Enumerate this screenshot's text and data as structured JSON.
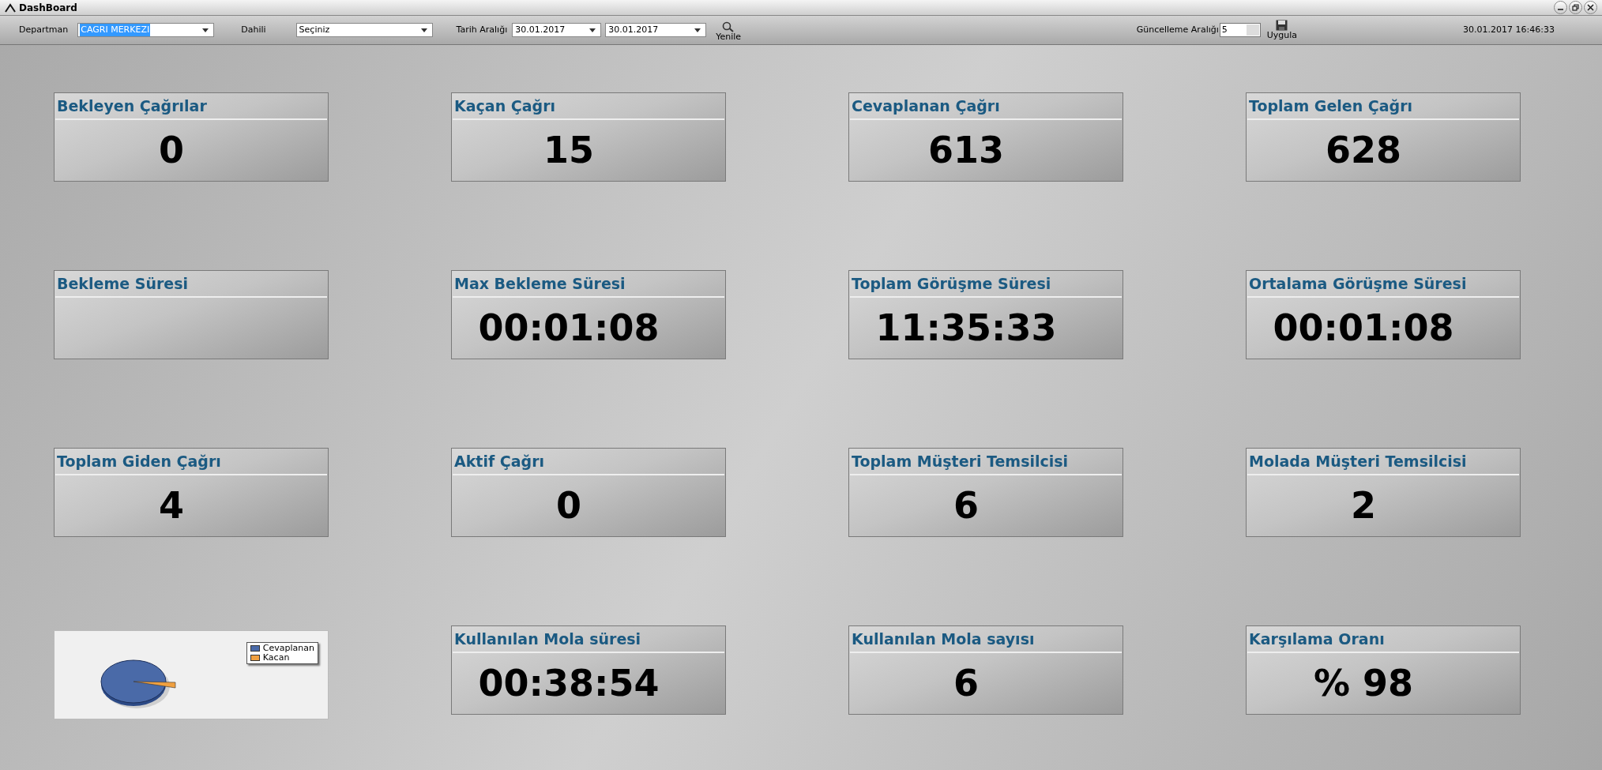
{
  "window": {
    "title": "DashBoard"
  },
  "toolbar": {
    "department_label": "Departman",
    "department_value": "CAGRI MERKEZI",
    "extension_label": "Dahili",
    "extension_value": "Seçiniz",
    "date_label": "Tarih Aralığı",
    "date_from": "30.01.2017",
    "date_to": "30.01.2017",
    "refresh_label": "Yenile",
    "interval_label": "Güncelleme Aralığı",
    "interval_value": "5",
    "apply_label": "Uygula",
    "timestamp": "30.01.2017 16:46:33"
  },
  "cards": [
    {
      "kind": "stat",
      "title": "Bekleyen Çağrılar",
      "value": "0"
    },
    {
      "kind": "stat",
      "title": "Kaçan Çağrı",
      "value": "15"
    },
    {
      "kind": "stat",
      "title": "Cevaplanan Çağrı",
      "value": "613"
    },
    {
      "kind": "stat",
      "title": "Toplam Gelen Çağrı",
      "value": "628"
    },
    {
      "kind": "stat",
      "title": "Bekleme Süresi"
    },
    {
      "kind": "stat",
      "title": "Max Bekleme Süresi",
      "value": "00:01:08"
    },
    {
      "kind": "stat",
      "title": "Toplam Görüşme Süresi",
      "value": "11:35:33"
    },
    {
      "kind": "stat",
      "title": "Ortalama Görüşme Süresi",
      "value": "00:01:08"
    },
    {
      "kind": "stat",
      "title": "Toplam Giden Çağrı",
      "value": "4"
    },
    {
      "kind": "stat",
      "title": "Aktif Çağrı",
      "value": "0"
    },
    {
      "kind": "stat",
      "title": "Toplam Müşteri Temsilcisi",
      "value": "6"
    },
    {
      "kind": "stat",
      "title": "Molada Müşteri Temsilcisi",
      "value": "2"
    },
    {
      "kind": "pie",
      "legend": [
        {
          "label": "Cevaplanan",
          "color": "#4a6aa8"
        },
        {
          "label": "Kacan",
          "color": "#f0a040"
        }
      ]
    },
    {
      "kind": "stat",
      "title": "Kullanılan Mola süresi",
      "value": "00:38:54"
    },
    {
      "kind": "stat",
      "title": "Kullanılan Mola sayısı",
      "value": "6"
    },
    {
      "kind": "stat",
      "title": "Karşılama Oranı",
      "value": "% 98"
    }
  ]
}
